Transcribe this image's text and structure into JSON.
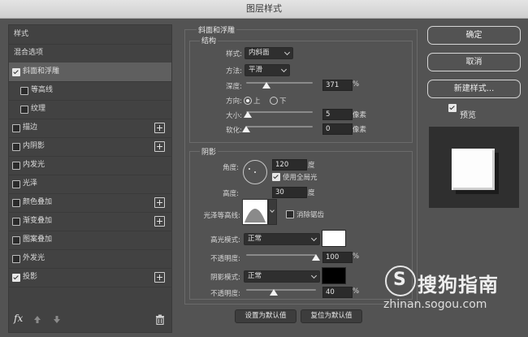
{
  "window": {
    "title": "图层样式"
  },
  "left_panel": {
    "items": [
      {
        "label": "样式",
        "checkbox": false,
        "checked": false,
        "plus": false,
        "selected": false,
        "sub": false,
        "header": true
      },
      {
        "label": "混合选项",
        "checkbox": false,
        "checked": false,
        "plus": false,
        "selected": false,
        "sub": false,
        "header": true
      },
      {
        "label": "斜面和浮雕",
        "checkbox": true,
        "checked": true,
        "plus": false,
        "selected": true,
        "sub": false
      },
      {
        "label": "等高线",
        "checkbox": true,
        "checked": false,
        "plus": false,
        "selected": false,
        "sub": true
      },
      {
        "label": "纹理",
        "checkbox": true,
        "checked": false,
        "plus": false,
        "selected": false,
        "sub": true
      },
      {
        "label": "描边",
        "checkbox": true,
        "checked": false,
        "plus": true,
        "selected": false,
        "sub": false
      },
      {
        "label": "内阴影",
        "checkbox": true,
        "checked": false,
        "plus": true,
        "selected": false,
        "sub": false
      },
      {
        "label": "内发光",
        "checkbox": true,
        "checked": false,
        "plus": false,
        "selected": false,
        "sub": false
      },
      {
        "label": "光泽",
        "checkbox": true,
        "checked": false,
        "plus": false,
        "selected": false,
        "sub": false
      },
      {
        "label": "颜色叠加",
        "checkbox": true,
        "checked": false,
        "plus": true,
        "selected": false,
        "sub": false
      },
      {
        "label": "渐变叠加",
        "checkbox": true,
        "checked": false,
        "plus": true,
        "selected": false,
        "sub": false
      },
      {
        "label": "图案叠加",
        "checkbox": true,
        "checked": false,
        "plus": false,
        "selected": false,
        "sub": false
      },
      {
        "label": "外发光",
        "checkbox": true,
        "checked": false,
        "plus": false,
        "selected": false,
        "sub": false
      },
      {
        "label": "投影",
        "checkbox": true,
        "checked": true,
        "plus": true,
        "selected": false,
        "sub": false
      }
    ],
    "fx_label": "fx"
  },
  "bevel": {
    "section_title": "斜面和浮雕",
    "structure_title": "结构",
    "style_label": "样式:",
    "style_value": "内斜面",
    "technique_label": "方法:",
    "technique_value": "平滑",
    "depth_label": "深度:",
    "depth_value": "371",
    "depth_percent": 0.31,
    "depth_unit": "%",
    "direction_label": "方向:",
    "direction_up": "上",
    "direction_down": "下",
    "size_label": "大小:",
    "size_value": "5",
    "size_unit": "像素",
    "size_percent": 0.02,
    "soften_label": "软化:",
    "soften_value": "0",
    "soften_unit": "像素",
    "soften_percent": 0.0
  },
  "shading": {
    "title": "阴影",
    "angle_label": "角度:",
    "angle_value": "120",
    "angle_unit": "度",
    "global_light_label": "使用全局光",
    "global_light_checked": true,
    "altitude_label": "高度:",
    "altitude_value": "30",
    "altitude_unit": "度",
    "gloss_contour_label": "光泽等高线:",
    "anti_alias_label": "消除锯齿",
    "anti_alias_checked": false,
    "highlight_mode_label": "高光模式:",
    "highlight_mode_value": "正常",
    "highlight_color": "#ffffff",
    "highlight_opacity_label": "不透明度:",
    "highlight_opacity_value": "100",
    "highlight_opacity_percent": 1.0,
    "highlight_opacity_unit": "%",
    "shadow_mode_label": "阴影模式:",
    "shadow_mode_value": "正常",
    "shadow_color": "#000000",
    "shadow_opacity_label": "不透明度:",
    "shadow_opacity_value": "40",
    "shadow_opacity_percent": 0.4,
    "shadow_opacity_unit": "%"
  },
  "footer_buttons": {
    "make_default": "设置为默认值",
    "reset_default": "复位为默认值"
  },
  "right": {
    "ok": "确定",
    "cancel": "取消",
    "new_style": "新建样式...",
    "preview_label": "预览",
    "preview_checked": true
  },
  "watermark": {
    "brand": "搜狗指南",
    "url": "zhinan.sogou.com"
  }
}
